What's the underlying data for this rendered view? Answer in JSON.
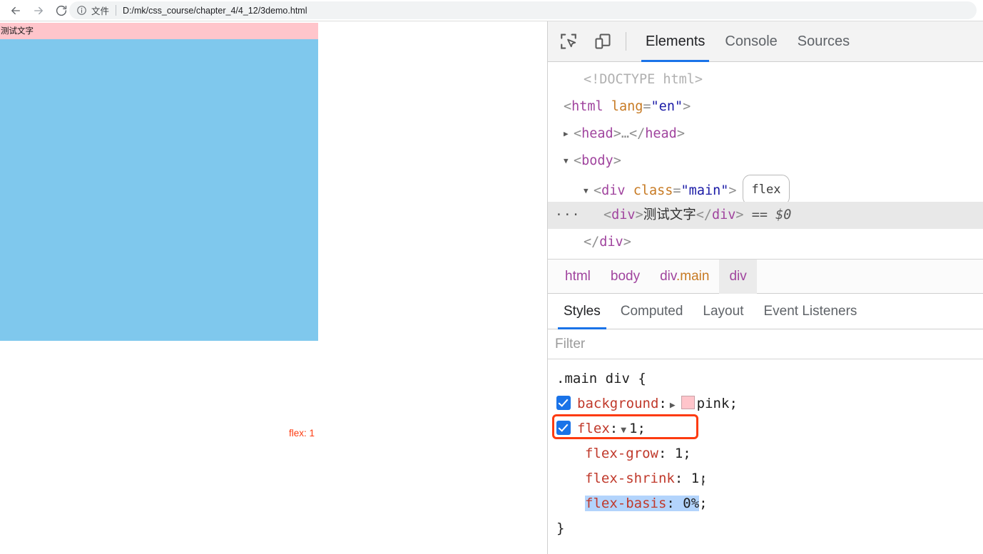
{
  "browser": {
    "back_label": "Back",
    "forward_label": "Forward",
    "reload_label": "Reload",
    "omnibox": {
      "info_icon": "info-circle-icon",
      "scheme_label": "文件",
      "url": "D:/mk/css_course/chapter_4/4_12/3demo.html"
    }
  },
  "page": {
    "pink_div_text": "测试文字",
    "pink_color": "#ffc5cb",
    "blue_color": "#7fc8ed",
    "annotation": "flex: 1",
    "annotation_color": "#fd3b10"
  },
  "devtools": {
    "toolbar_icons": [
      {
        "name": "inspect-element-icon"
      },
      {
        "name": "device-toolbar-icon"
      }
    ],
    "tabs": [
      {
        "label": "Elements",
        "selected": true
      },
      {
        "label": "Console",
        "selected": false
      },
      {
        "label": "Sources",
        "selected": false
      }
    ],
    "dom": {
      "doctype": "<!DOCTYPE html>",
      "html_open_tag": "<html",
      "html_attr_name": "lang",
      "html_attr_value": "\"en\"",
      "html_close_bracket": ">",
      "head_collapsed": "<head>…</head>",
      "body_open": "<body>",
      "div_main_open": "<div",
      "div_main_attr": "class",
      "div_main_value": "\"main\"",
      "flex_badge": "flex",
      "selected_open_tag": "<div>",
      "selected_text": "测试文字",
      "selected_close_tag": "</div>",
      "selected_ref": "== $0",
      "div_close": "</div>",
      "ellipsis_menu": "···"
    },
    "breadcrumb": [
      {
        "tag": "html",
        "cls": "",
        "active": false
      },
      {
        "tag": "body",
        "cls": "",
        "active": false
      },
      {
        "tag": "div",
        "cls": ".main",
        "active": false
      },
      {
        "tag": "div",
        "cls": "",
        "active": true
      }
    ],
    "sidebar_tabs": [
      {
        "label": "Styles",
        "selected": true
      },
      {
        "label": "Computed",
        "selected": false
      },
      {
        "label": "Layout",
        "selected": false
      },
      {
        "label": "Event Listeners",
        "selected": false
      }
    ],
    "filter": {
      "placeholder": "Filter",
      "value": ""
    },
    "styles_rule": {
      "selector": ".main div {",
      "closing_brace": "}",
      "declarations": [
        {
          "checked": true,
          "property": "background",
          "expander": "▶",
          "swatch_color": "#ffc5cb",
          "value": "pink",
          "terminator": ";",
          "highlighted": false
        },
        {
          "checked": true,
          "property": "flex",
          "expander": "▼",
          "value": "1",
          "terminator": ";",
          "highlighted": true
        }
      ],
      "longhands": [
        {
          "property": "flex-grow",
          "value": "1",
          "terminator": ";",
          "selected": false
        },
        {
          "property": "flex-shrink",
          "value": "1",
          "terminator": ";",
          "selected": false
        },
        {
          "property": "flex-basis",
          "value": "0%",
          "terminator": ";",
          "selected": true
        }
      ]
    }
  }
}
